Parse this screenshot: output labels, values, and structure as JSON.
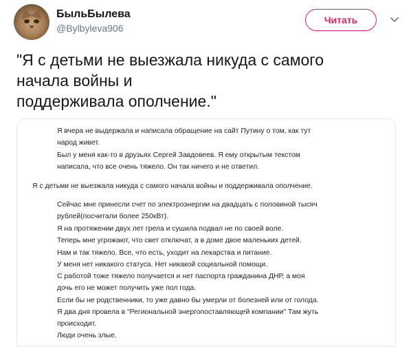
{
  "author": {
    "display_name": "БыльБылева",
    "handle": "@Bylbyleva906",
    "avatar": "cat-avatar"
  },
  "actions": {
    "follow_label": "Читать",
    "menu_icon": "chevron-down-icon"
  },
  "tweet": {
    "lines": [
      "\"Я с детьми не выезжала никуда с самого",
      "начала войны и",
      "поддерживала ополчение.\""
    ]
  },
  "media_text": {
    "lines": [
      "Я вчера не выдержала и написала обращение на сайт Путину о том, как тут",
      "народ живет.",
      "Был у меня как-то в друзьях Сергей Завдовеев. Я ему открытым текстом",
      "написала, что все очень тяжело. Он так ничего и не ответил.",
      "Я с детьми не выезжала никуда с самого начала войны и поддерживала  ополчение.",
      "Сейчас мне принесли счет по электроэнергии на двадцать с половиной тысяч",
      "рублей(посчитали более 250кВт).",
      "Я на протяжении двух лет грела и сушила подвал не по своей воле.",
      "Теперь мне угрожают, что свет отключат, а в доме двое маленьких детей.",
      "Нам и так тяжело. Все, что есть, уходит на лекарства и питание.",
      "У меня нет никакого статуса. Нет никакой социальной помощи.",
      "С работой тоже тяжело получается и нет паспорта гражданина ДНР, а моя",
      "дочь его не может получить уже пол года.",
      "Если бы не родственники, то уже давно бы умерли от болезней или от голода.",
      "Я два дня провела в \"Региональной энергопоставляющей компании\" Там жуть",
      "происходит.",
      "Люди очень злые."
    ]
  },
  "colors": {
    "accent": "#e0245e",
    "secondary_text": "#657786",
    "border": "#e1e8ed"
  }
}
